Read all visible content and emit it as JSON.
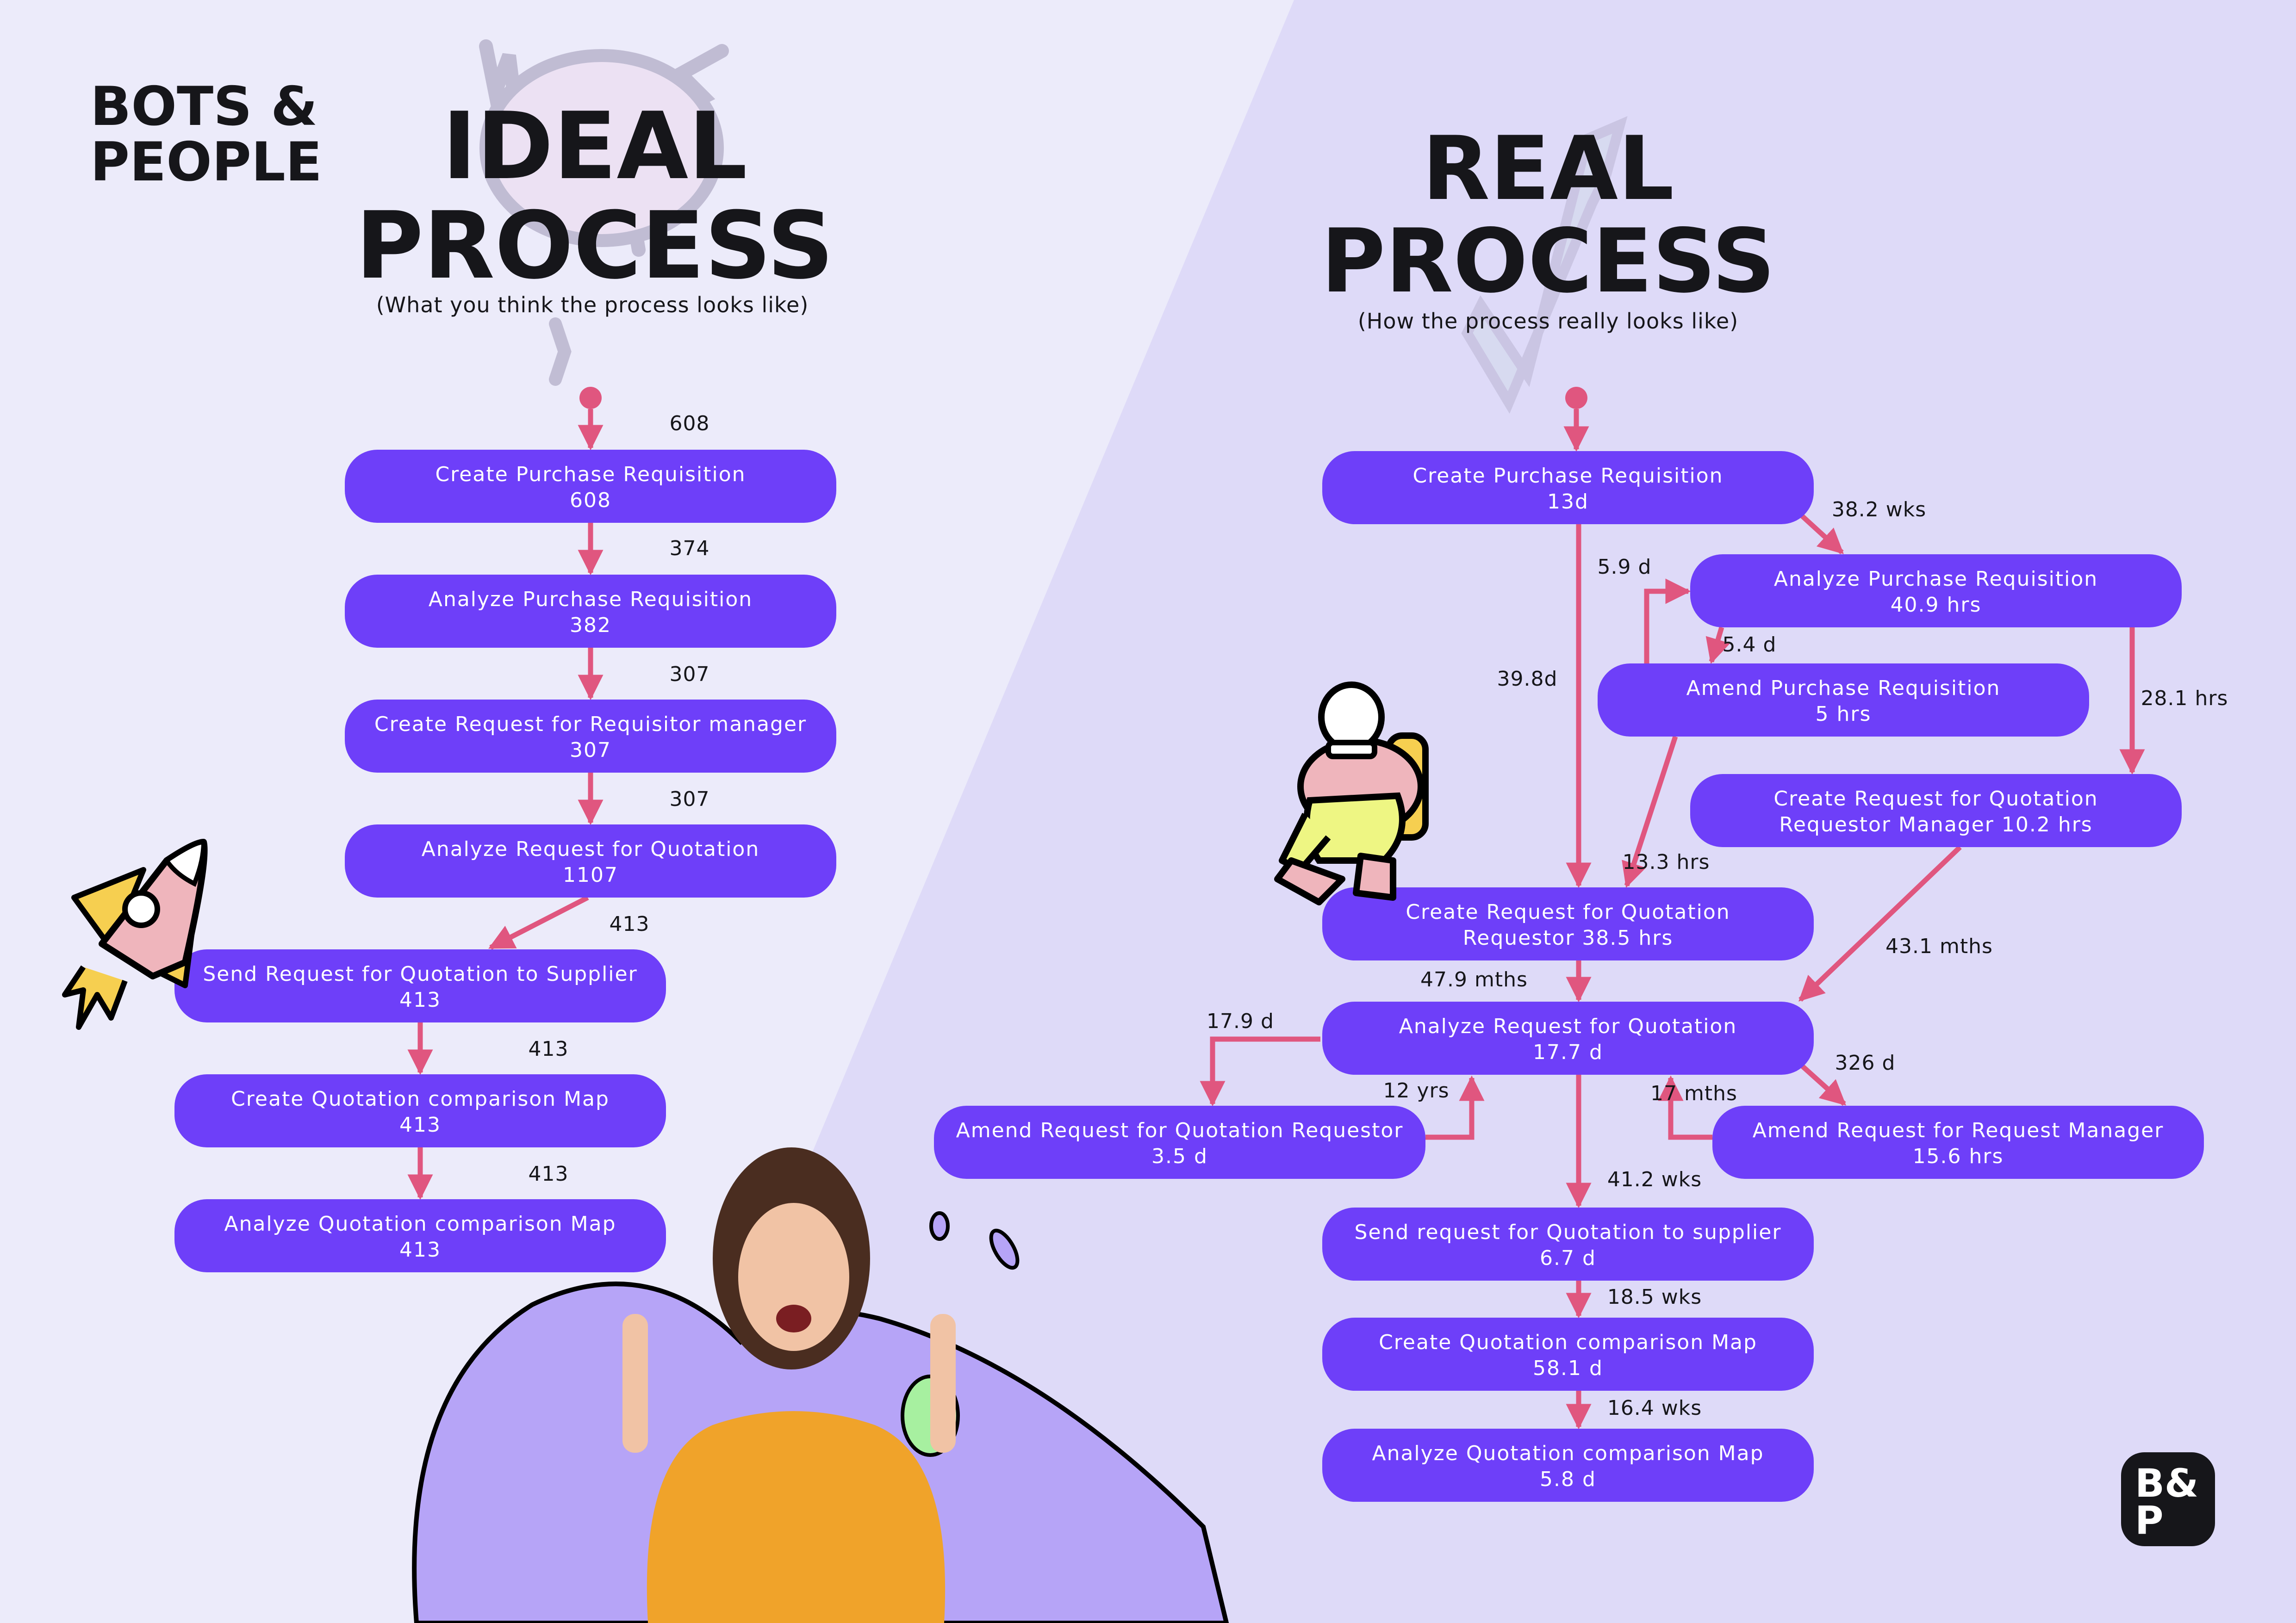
{
  "brand": {
    "line1": "BOTS &",
    "line2": "PEOPLE",
    "logo_line1": "B&",
    "logo_line2": "P"
  },
  "ideal": {
    "title_line1": "IDEAL",
    "title_line2": "PROCESS",
    "subtitle": "(What you think the process looks like)",
    "nodes": [
      {
        "id": "i1",
        "label": "Create Purchase Requisition",
        "value": "608"
      },
      {
        "id": "i2",
        "label": "Analyze Purchase Requisition",
        "value": "382"
      },
      {
        "id": "i3",
        "label": "Create Request for Requisitor manager",
        "value": "307"
      },
      {
        "id": "i4",
        "label": "Analyze Request for Quotation",
        "value": "1107"
      },
      {
        "id": "i5",
        "label": "Send Request for Quotation to Supplier",
        "value": "413"
      },
      {
        "id": "i6",
        "label": "Create Quotation comparison Map",
        "value": "413"
      },
      {
        "id": "i7",
        "label": "Analyze Quotation comparison Map",
        "value": "413"
      }
    ],
    "edges": [
      {
        "from": "start",
        "to": "i1",
        "label": "608"
      },
      {
        "from": "i1",
        "to": "i2",
        "label": "374"
      },
      {
        "from": "i2",
        "to": "i3",
        "label": "307"
      },
      {
        "from": "i3",
        "to": "i4",
        "label": "307"
      },
      {
        "from": "i4",
        "to": "i5",
        "label": "413"
      },
      {
        "from": "i5",
        "to": "i6",
        "label": "413"
      },
      {
        "from": "i6",
        "to": "i7",
        "label": "413"
      }
    ]
  },
  "real": {
    "title_line1": "REAL",
    "title_line2": "PROCESS",
    "subtitle": "(How the process really looks like)",
    "nodes": [
      {
        "id": "r1",
        "label": "Create Purchase Requisition",
        "value": "13d"
      },
      {
        "id": "r2",
        "label": "Analyze Purchase Requisition",
        "value": "40.9 hrs"
      },
      {
        "id": "r3",
        "label": "Amend Purchase Requisition",
        "value": "5 hrs"
      },
      {
        "id": "r4",
        "label": "Create Request for Quotation",
        "value": "Requestor Manager 10.2 hrs"
      },
      {
        "id": "r5",
        "label": "Create Request for Quotation",
        "value": "Requestor 38.5 hrs"
      },
      {
        "id": "r6",
        "label": "Analyze Request for Quotation",
        "value": "17.7 d"
      },
      {
        "id": "r7",
        "label": "Amend Request for Quotation Requestor",
        "value": "3.5 d"
      },
      {
        "id": "r8",
        "label": "Amend Request for Request Manager",
        "value": "15.6 hrs"
      },
      {
        "id": "r9",
        "label": "Send request for Quotation to supplier",
        "value": "6.7 d"
      },
      {
        "id": "r10",
        "label": "Create Quotation comparison Map",
        "value": "58.1 d"
      },
      {
        "id": "r11",
        "label": "Analyze Quotation comparison Map",
        "value": "5.8 d"
      }
    ],
    "edges": [
      {
        "from": "start",
        "to": "r1",
        "label": ""
      },
      {
        "from": "r1",
        "to": "r2",
        "label": "38.2 wks"
      },
      {
        "from": "r1",
        "to": "r5",
        "label": "39.8d"
      },
      {
        "from": "r3",
        "to": "r2",
        "label": "5.9 d"
      },
      {
        "from": "r2",
        "to": "r3",
        "label": "5.4 d"
      },
      {
        "from": "r2",
        "to": "r4",
        "label": "28.1 hrs"
      },
      {
        "from": "r3",
        "to": "r5",
        "label": "13.3 hrs"
      },
      {
        "from": "r4",
        "to": "r6",
        "label": "43.1 mths"
      },
      {
        "from": "r5",
        "to": "r6",
        "label": "47.9 mths"
      },
      {
        "from": "r6",
        "to": "r7",
        "label": "17.9 d"
      },
      {
        "from": "r7",
        "to": "r6",
        "label": "12 yrs"
      },
      {
        "from": "r6",
        "to": "r8",
        "label": "326 d"
      },
      {
        "from": "r8",
        "to": "r6",
        "label": "17 mths"
      },
      {
        "from": "r6",
        "to": "r9",
        "label": "41.2 wks"
      },
      {
        "from": "r9",
        "to": "r10",
        "label": "18.5 wks"
      },
      {
        "from": "r10",
        "to": "r11",
        "label": "16.4 wks"
      }
    ]
  },
  "colors": {
    "node_fill": "#6e3ff9",
    "edge": "#e0567f",
    "text_dark": "#16161a",
    "bg_left": "#ecebfa",
    "bg_right": "#dedaf8"
  },
  "illustrations": [
    "brain-doodle",
    "lightning-doodle",
    "rocket",
    "astronaut",
    "woman-pointing-up",
    "purple-splash"
  ]
}
